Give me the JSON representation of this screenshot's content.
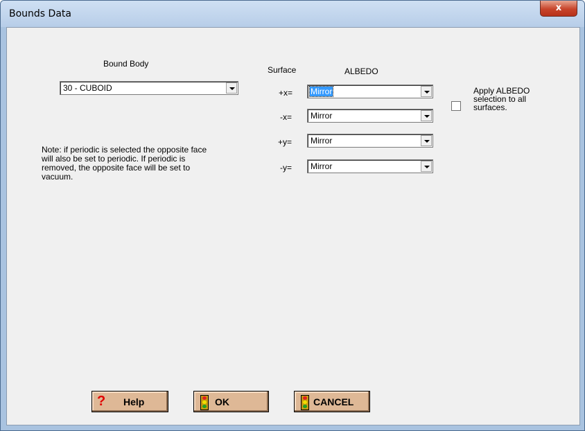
{
  "window": {
    "title": "Bounds Data",
    "close_label": "x"
  },
  "bound_body": {
    "label": "Bound Body",
    "value": "30 - CUBOID"
  },
  "surface": {
    "header_label": "Surface",
    "albedo_label": "ALBEDO",
    "rows": [
      {
        "label": "+x=",
        "value": "Mirror"
      },
      {
        "label": "-x=",
        "value": "Mirror"
      },
      {
        "label": "+y=",
        "value": "Mirror"
      },
      {
        "label": "-y=",
        "value": "Mirror"
      }
    ]
  },
  "apply_all": {
    "label": "Apply ALBEDO selection to all surfaces.",
    "checked": false
  },
  "note": "Note: if periodic is selected the opposite face\nwill also be set to periodic.  If periodic is\nremoved, the opposite face will be set to\nvacuum.",
  "buttons": {
    "help": "Help",
    "ok": "OK",
    "cancel": "CANCEL"
  },
  "colors": {
    "button_bg": "#deb896",
    "selection": "#3399ff",
    "titlebar": "#b7cde8"
  }
}
